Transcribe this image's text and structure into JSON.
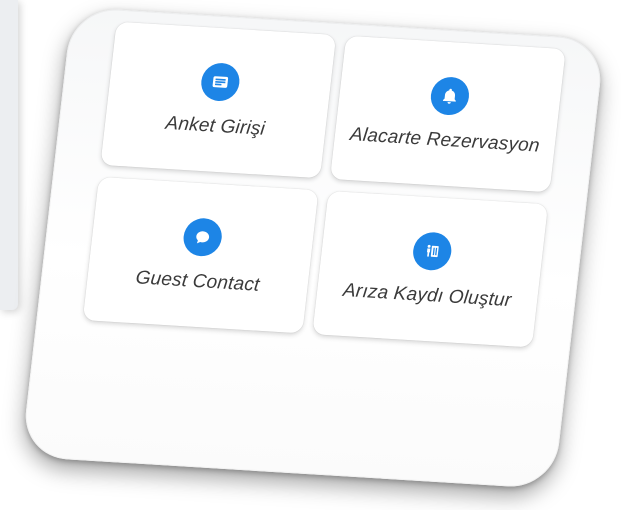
{
  "menu": {
    "tiles": [
      {
        "label": "Anket Girişi",
        "icon": "survey-form-icon"
      },
      {
        "label": "Alacarte Rezervasyon",
        "icon": "bell-icon"
      },
      {
        "label": "Guest Contact",
        "icon": "chat-bubble-icon"
      },
      {
        "label": "Arıza Kaydı Oluştur",
        "icon": "repair-worker-icon"
      }
    ]
  },
  "colors": {
    "accent": "#1d85e6",
    "label_text": "#3a3a3a",
    "tile_background": "#ffffff"
  }
}
